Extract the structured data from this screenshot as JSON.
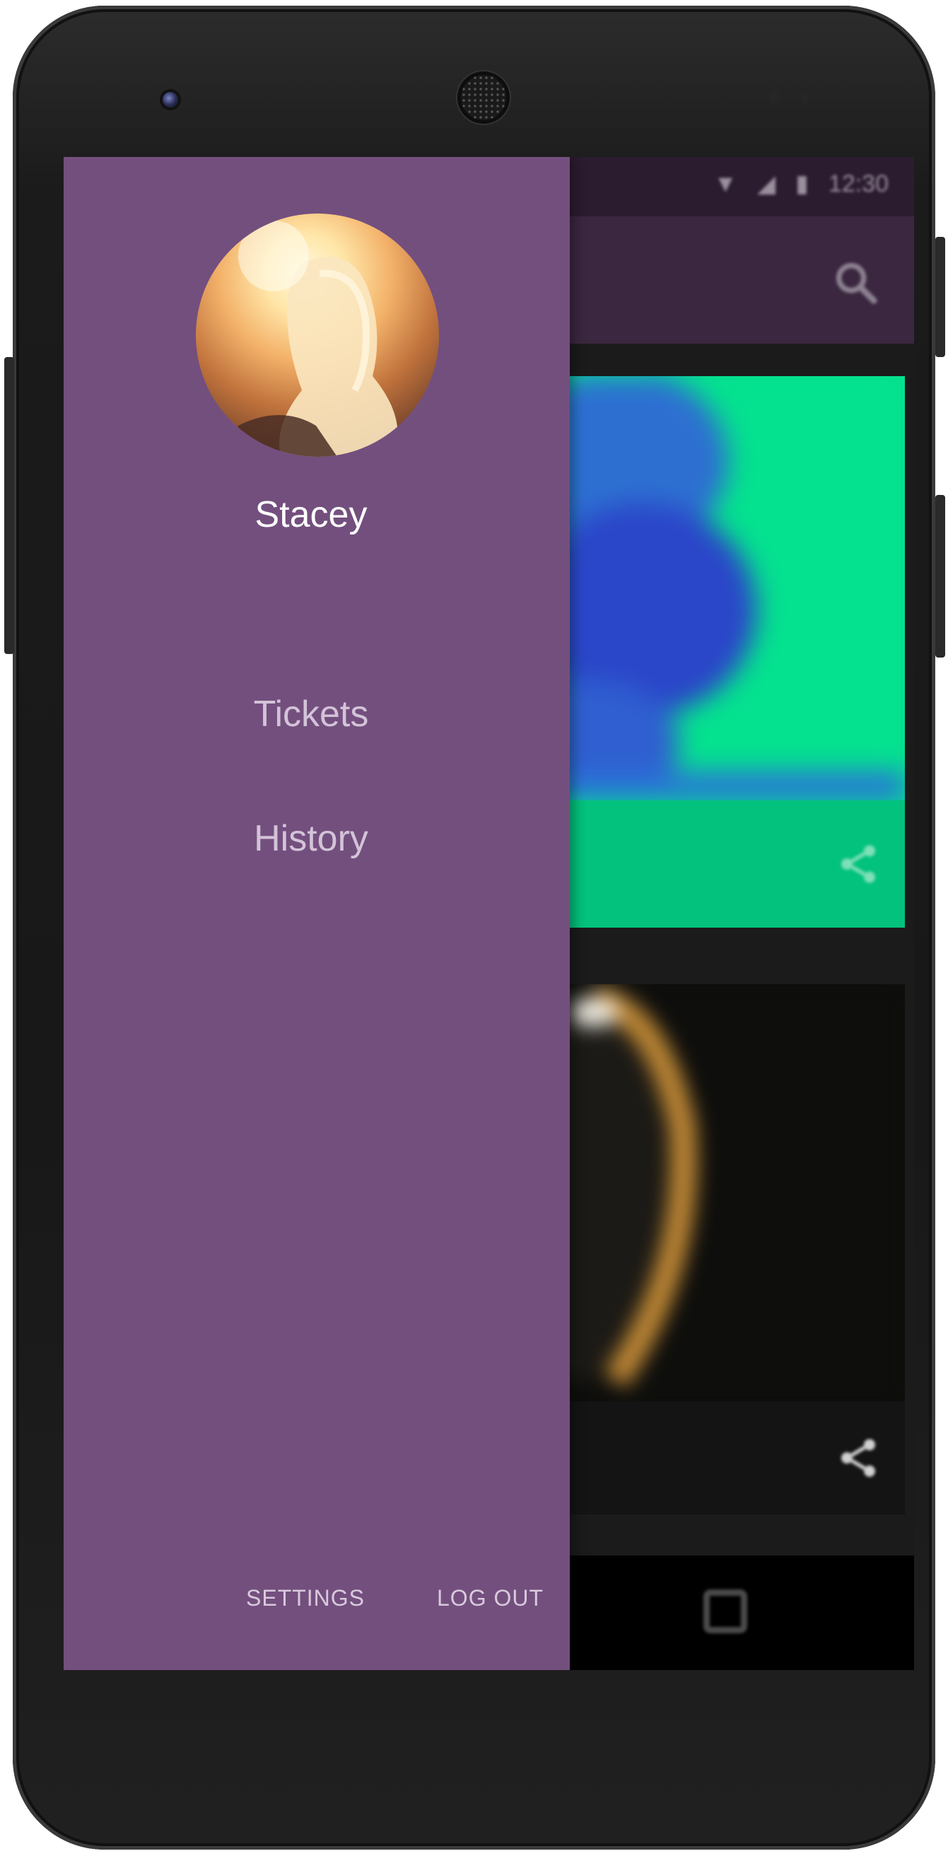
{
  "drawer": {
    "user_name": "Stacey",
    "menu": [
      {
        "label": "Tickets"
      },
      {
        "label": "History"
      }
    ],
    "footer": {
      "settings_label": "SETTINGS",
      "logout_label": "LOG OUT"
    },
    "background_color": "#734f7e"
  },
  "status_bar": {
    "time": "12:30",
    "icons": [
      "wifi-icon",
      "signal-icon",
      "battery-icon"
    ]
  },
  "app_bar": {
    "icons": [
      "search-icon"
    ]
  },
  "cards": [
    {
      "icon": "share-icon",
      "color": "#04e18f"
    },
    {
      "icon": "share-icon",
      "color": "#0e0e0c"
    }
  ],
  "nav_bar": {
    "icons": [
      "recents-icon"
    ]
  }
}
